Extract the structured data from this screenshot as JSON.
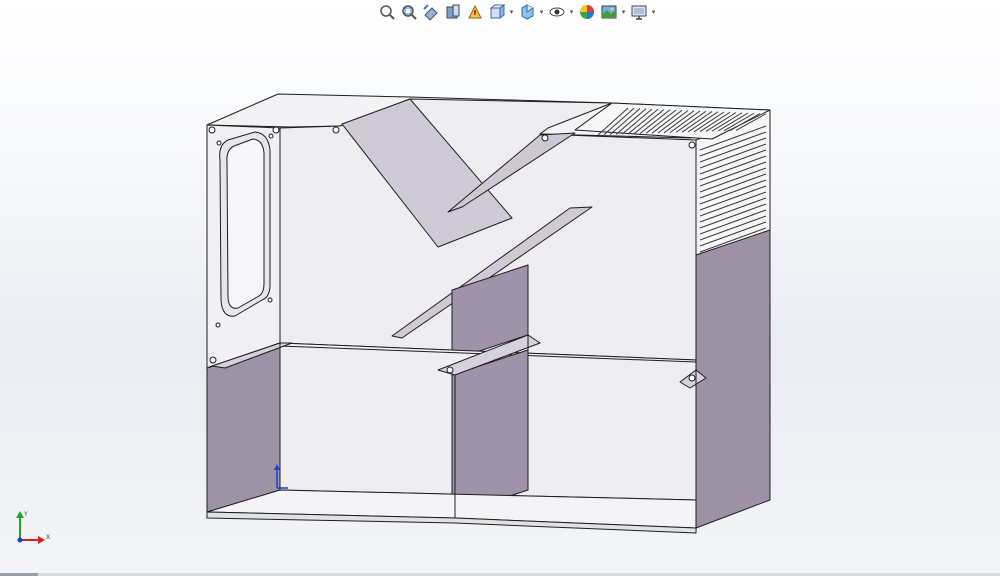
{
  "app": "CAD 3D viewport",
  "heads_up_toolbar": {
    "tools": [
      {
        "name": "zoom-to-fit",
        "icon": "zoom-fit-icon"
      },
      {
        "name": "zoom-to-area",
        "icon": "zoom-area-icon"
      },
      {
        "name": "previous-view",
        "icon": "previous-view-icon"
      },
      {
        "name": "section-view",
        "icon": "section-view-icon"
      },
      {
        "name": "dynamic-annotation-views",
        "icon": "annotation-view-icon"
      },
      {
        "name": "view-orientation",
        "icon": "view-orientation-icon",
        "dropdown": true
      },
      {
        "name": "display-style",
        "icon": "display-style-icon",
        "dropdown": true
      },
      {
        "name": "hide-show-items",
        "icon": "hide-show-icon",
        "dropdown": true
      },
      {
        "name": "edit-appearance",
        "icon": "appearance-icon"
      },
      {
        "name": "apply-scene",
        "icon": "scene-icon",
        "dropdown": true
      },
      {
        "name": "view-settings",
        "icon": "monitor-icon",
        "dropdown": true
      }
    ]
  },
  "model": {
    "description_hidden": true,
    "face_color": "#f0eff3",
    "shaded_face_color": "#9a8fa3",
    "edge_color": "#1e1e1e"
  },
  "triad": {
    "x_label": "X",
    "y_label": "Y",
    "x_color": "#d42020",
    "y_color": "#1fa52a",
    "z_color": "#1f3fd0"
  }
}
